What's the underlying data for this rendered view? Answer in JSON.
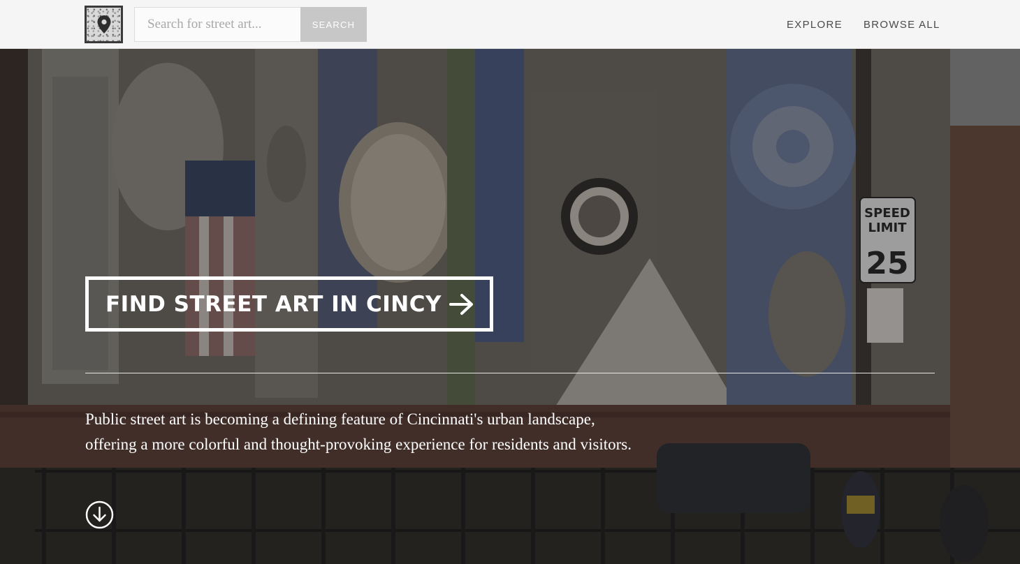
{
  "navbar": {
    "logo_icon": "map-pin-icon",
    "search": {
      "placeholder": "Search for street art...",
      "value": "",
      "button_label": "SEARCH"
    },
    "links": [
      {
        "label": "EXPLORE"
      },
      {
        "label": "BROWSE ALL"
      }
    ]
  },
  "hero": {
    "cta_label": "FIND STREET ART IN CINCY",
    "cta_icon": "arrow-right-icon",
    "intro_line1": "Public street art is becoming a defining feature of Cincinnati's urban landscape,",
    "intro_line2": "offering a more colorful and thought-provoking experience for residents and visitors.",
    "scroll_icon": "arrow-down-circle-icon",
    "sign_speed": "SPEED",
    "sign_limit": "LIMIT",
    "sign_number": "25"
  },
  "colors": {
    "nav_bg": "#f5f5f5",
    "search_button_bg": "#c7c7c7",
    "nav_text": "#4a4a4a",
    "hero_text": "#ffffff"
  }
}
